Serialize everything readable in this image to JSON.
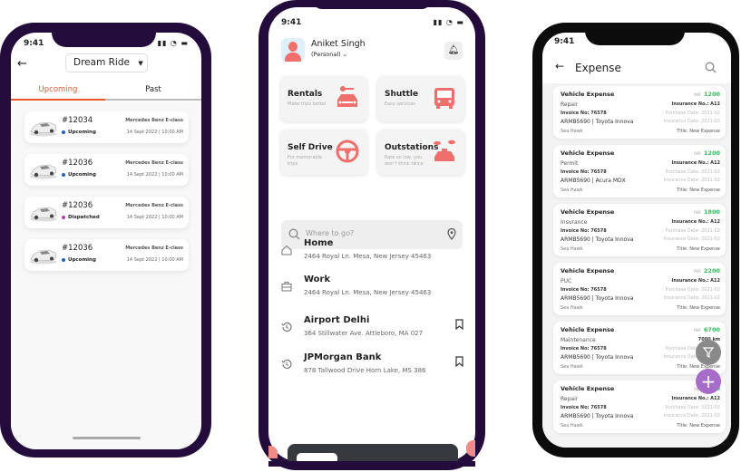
{
  "colors": {
    "frame": "#230b3b",
    "accent_orange": "#e8572a",
    "service_icon": "#ef6f6c",
    "amount_green": "#3cb85b",
    "fab_purple": "#a66cc7",
    "fab_gray": "#8a8a8a",
    "status_upcoming": "#1f5fbf",
    "status_dispatched": "#b23fb5"
  },
  "bookings_screen": {
    "time": "9:41",
    "title": "Dream Ride",
    "tabs": [
      {
        "label": "Upcoming",
        "active": true
      },
      {
        "label": "Past",
        "active": false
      }
    ],
    "rides": [
      {
        "id": "#12034",
        "status": "Upcoming",
        "model": "Mercedes Benz E-class",
        "date": "14 Sept 2022 | 10:00 AM"
      },
      {
        "id": "#12036",
        "status": "Upcoming",
        "model": "Mercedes Benz E-class",
        "date": "14 Sept 2022 | 10:00 AM"
      },
      {
        "id": "#12036",
        "status": "Dispatched",
        "model": "Mercedes Benz E-class",
        "date": "14 Sept 2022 | 10:00 AM"
      },
      {
        "id": "#12036",
        "status": "Upcoming",
        "model": "Mercedes Benz E-class",
        "date": "14 Sept 2022 | 10:00 AM"
      }
    ]
  },
  "home_screen": {
    "time": "9:41",
    "user_name": "Aniket Singh",
    "account_type": "(Personal)",
    "services": [
      {
        "title": "Rentals",
        "subtitle": "Make trips better",
        "icon": "car-key-icon"
      },
      {
        "title": "Shuttle",
        "subtitle": "Easy services",
        "icon": "bus-icon"
      },
      {
        "title": "Self Drive",
        "subtitle": "For memorable trips",
        "icon": "steering-wheel-icon"
      },
      {
        "title": "Outstations",
        "subtitle": "Rate so low, you won't think twice",
        "icon": "taxi-icon"
      }
    ],
    "search_placeholder": "Where to go?",
    "locations": [
      {
        "name": "Home",
        "address": "2464 Royal Ln. Mesa, New Jersey 45463",
        "icon": "home-icon"
      },
      {
        "name": "Work",
        "address": "2464 Royal Ln. Mesa, New Jersey 45463",
        "icon": "briefcase-icon"
      },
      {
        "name": "Airport Delhi",
        "address": "364 Stillwater Ave. Attleboro, MA 027",
        "icon": "history-icon"
      },
      {
        "name": "JPMorgan Bank",
        "address": "878 Tallwood Drive Horn Lake, MS 386",
        "icon": "history-icon"
      }
    ]
  },
  "expense_screen": {
    "time": "9:41",
    "title": "Expense",
    "items": [
      {
        "heading": "Vehicle Expense",
        "category": "Repair",
        "currency": "INR",
        "amount": "1200",
        "insurance": "Insurance No.: A12",
        "invoice": "Invoice No: 76578",
        "vehicle": "ARMB5690 | Toyota Innova",
        "purchase": "Purchase Date: 2021-02",
        "insurance_date": "Insurance Date: 2021-02",
        "owner": "Sea Hawk",
        "title": "Title: New Expense"
      },
      {
        "heading": "Vehicle Expense",
        "category": "Permit",
        "currency": "INR",
        "amount": "1200",
        "insurance": "Insurance No.: A12",
        "invoice": "Invoice No: 76578",
        "vehicle": "ARMB5690 | Acura MDX",
        "purchase": "Purchase Date: 2021-02",
        "insurance_date": "Insurance Date: 2021-02",
        "owner": "Sea Hawk",
        "title": "Title: New Expense"
      },
      {
        "heading": "Vehicle Expense",
        "category": "Insurance",
        "currency": "INR",
        "amount": "1800",
        "insurance": "Insurance No.: A12",
        "invoice": "Invoice No: 76578",
        "vehicle": "ARMB5690 | Toyota Innova",
        "purchase": "Purchase Date: 2021-02",
        "insurance_date": "Insurance Date: 2021-02",
        "owner": "Sea Hawk",
        "title": "Title: New Expense"
      },
      {
        "heading": "Vehicle Expense",
        "category": "PUC",
        "currency": "INR",
        "amount": "2200",
        "insurance": "Insurance No.: A12",
        "invoice": "Invoice No: 76578",
        "vehicle": "ARMB5690 | Toyota Innova",
        "purchase": "Purchase Date: 2021-02",
        "insurance_date": "Insurance Date: 2021-02",
        "owner": "Sea Hawk",
        "title": "Title: New Expense"
      },
      {
        "heading": "Vehicle Expense",
        "category": "Maintenance",
        "currency": "INR",
        "amount": "6700",
        "insurance": "7000 km",
        "invoice": "Invoice No: 76578",
        "vehicle": "ARMB5690 | Toyota Innova",
        "purchase": "Purchase Date: 2021-02",
        "insurance_date": "Insurance Date: 2021-02",
        "owner": "Sea Hawk",
        "title": "Title: New Expense"
      },
      {
        "heading": "Vehicle Expense",
        "category": "Repair",
        "currency": "INR",
        "amount": "1200",
        "insurance": "Insurance No.: A12",
        "invoice": "Invoice No: 76578",
        "vehicle": "ARMB5690 | Toyota Innova",
        "purchase": "Purchase Date: 2021-02",
        "insurance_date": "Insurance Date: 2021-02",
        "owner": "Sea Hawk",
        "title": "Title: New Expense"
      }
    ]
  }
}
